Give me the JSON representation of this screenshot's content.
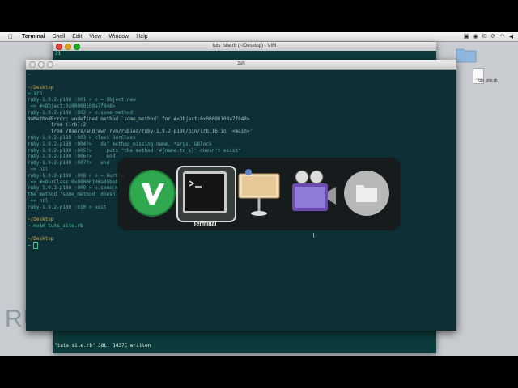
{
  "menubar": {
    "app_name": "Terminal",
    "items": [
      "Shell",
      "Edit",
      "View",
      "Window",
      "Help"
    ]
  },
  "desktop": {
    "file_label": "tuts_site.rb"
  },
  "vim_window": {
    "title": "tuts_site.rb (~/Desktop) - VIM",
    "line_no": "21",
    "status": "\"tuts_site.rb\" 38L, 1437C written"
  },
  "terminal_window": {
    "title": "zsh",
    "lines": [
      {
        "text": "~",
        "cls": "c-green"
      },
      {
        "text": "",
        "cls": "c-text"
      },
      {
        "text": "~/Desktop",
        "cls": "c-prompt"
      },
      {
        "text": "→ irb",
        "cls": "c-green"
      },
      {
        "text": "ruby-1.9.2-p180 :001 > o = Object.new",
        "cls": "c-text"
      },
      {
        "text": " => #<Object:0x00000100a7f048>",
        "cls": "c-text"
      },
      {
        "text": "ruby-1.9.2-p180 :002 > o.some_method",
        "cls": "c-text"
      },
      {
        "text": "NoMethodError: undefined method `some_method' for #<Object:0x00000100a7f048>",
        "cls": "c-err"
      },
      {
        "text": "        from (irb):2",
        "cls": "c-err"
      },
      {
        "text": "        from /Users/andrew/.rvm/rubies/ruby-1.9.2-p180/bin/irb:16:in `<main>'",
        "cls": "c-err"
      },
      {
        "text": "ruby-1.9.2-p180 :003 > class OurClass",
        "cls": "c-text"
      },
      {
        "text": "ruby-1.9.2-p180 :004?>   def method_missing name, *args, &block",
        "cls": "c-text"
      },
      {
        "text": "ruby-1.9.2-p180 :005?>     puts \"the method '#{name.to_s}' doesn't exist\"",
        "cls": "c-text"
      },
      {
        "text": "ruby-1.9.2-p180 :006?>     end",
        "cls": "c-text"
      },
      {
        "text": "ruby-1.9.2-p180 :007?>   end",
        "cls": "c-text"
      },
      {
        "text": " => nil",
        "cls": "c-text"
      },
      {
        "text": "ruby-1.9.2-p180 :008 > o = OurCla",
        "cls": "c-text"
      },
      {
        "text": " => #<OurClass:0x00000100a95be8>",
        "cls": "c-text"
      },
      {
        "text": "ruby-1.9.2-p180 :009 > o.some_m",
        "cls": "c-text"
      },
      {
        "text": "the method 'some_method' doesn",
        "cls": "c-text"
      },
      {
        "text": " => nil",
        "cls": "c-text"
      },
      {
        "text": "ruby-1.9.2-p180 :010 > exit",
        "cls": "c-text"
      },
      {
        "text": "",
        "cls": "c-text"
      },
      {
        "text": "~/Desktop",
        "cls": "c-prompt"
      },
      {
        "text": "→ mvim tuts_site.rb",
        "cls": "c-green"
      },
      {
        "text": "",
        "cls": "c-text"
      },
      {
        "text": "~/Desktop",
        "cls": "c-prompt"
      }
    ]
  },
  "app_switcher": {
    "selected_label": "Terminal",
    "apps": [
      "vim-icon",
      "terminal-icon",
      "keynote-icon",
      "imovie-icon",
      "folder-icon"
    ]
  },
  "backdrop_text": "RUB",
  "colors": {
    "terminal_bg": "#0e2f36",
    "prompt": "#d1a53c",
    "green": "#3ec78a"
  }
}
